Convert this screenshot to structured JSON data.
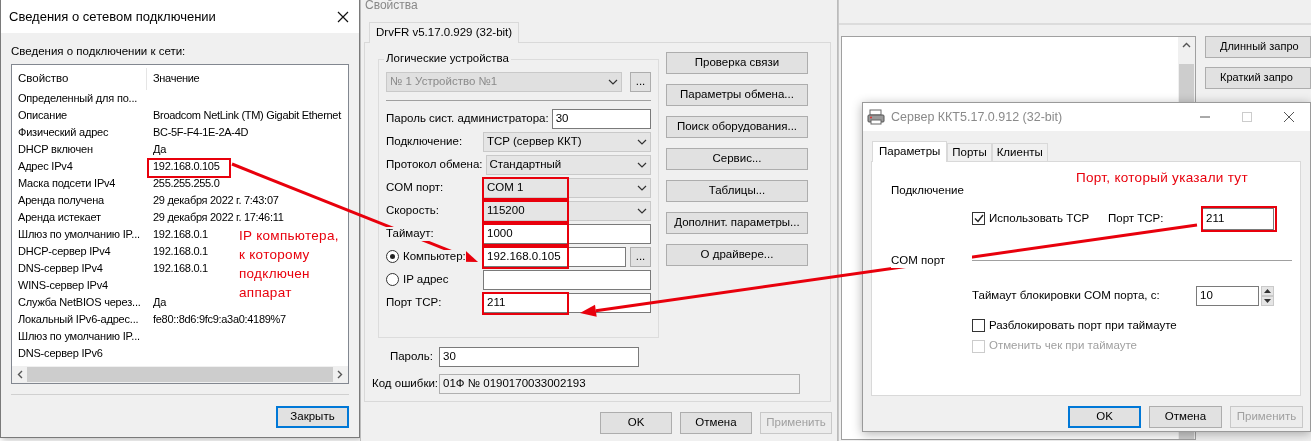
{
  "network_details_window": {
    "title": "Сведения о сетевом подключении",
    "caption": "Сведения о подключении к сети:",
    "columns": [
      "Свойство",
      "Значение"
    ],
    "rows": [
      {
        "property": "Определенный для по...",
        "highlighted": false
      },
      {
        "property": "Описание",
        "value": "Broadcom NetLink (TM) Gigabit Ethernet",
        "highlighted": false
      },
      {
        "property": "Физический адрес",
        "value": "BC-5F-F4-1E-2A-4D",
        "highlighted": false
      },
      {
        "property": "DHCP включен",
        "value": "Да",
        "highlighted": false
      },
      {
        "property": "Адрес IPv4",
        "value": "192.168.0.105",
        "highlighted": true
      },
      {
        "property": "Маска подсети IPv4",
        "value": "255.255.255.0",
        "highlighted": false
      },
      {
        "property": "Аренда получена",
        "value": "29 декабря 2022 г. 7:43:07",
        "highlighted": false
      },
      {
        "property": "Аренда истекает",
        "value": "29 декабря 2022 г. 17:46:11",
        "highlighted": false
      },
      {
        "property": "Шлюз по умолчанию IP...",
        "value": "192.168.0.1",
        "highlighted": false
      },
      {
        "property": "DHCP-сервер IPv4",
        "value": "192.168.0.1",
        "highlighted": false
      },
      {
        "property": "DNS-сервер IPv4",
        "value": "192.168.0.1",
        "highlighted": false
      },
      {
        "property": "WINS-сервер IPv4",
        "highlighted": false
      },
      {
        "property": "Служба NetBIOS через...",
        "value": "Да",
        "highlighted": false
      },
      {
        "property": "Локальный IPv6-адрес...",
        "value": "fe80::8d6:9fc9:a3a0:4189%7",
        "highlighted": false
      },
      {
        "property": "Шлюз по умолчанию IP...",
        "highlighted": false
      },
      {
        "property": "DNS-сервер IPv6",
        "highlighted": false
      }
    ],
    "buttons": [
      {
        "label": "Закрыть",
        "default": true,
        "disabled": false
      }
    ]
  },
  "properties_window": {
    "title": "Свойства",
    "tabs": [
      {
        "label": "DrvFR v5.17.0.929 (32-bit)",
        "selected": true
      }
    ],
    "group_label": "Логические устройства",
    "device": {
      "value": "№ 1 Устройство №1",
      "disabled": true,
      "browse_button": "..."
    },
    "fields": [
      {
        "kind": "input",
        "label": "Пароль сист. администратора:",
        "value": "30",
        "highlighted": false
      },
      {
        "kind": "select",
        "label": "Подключение:",
        "value": "TCP (сервер ККТ)",
        "highlighted": false
      },
      {
        "kind": "select",
        "label": "Протокол обмена:",
        "value": "Стандартный",
        "highlighted": false
      },
      {
        "kind": "select",
        "label": "COM порт:",
        "value": "COM 1",
        "highlighted": true
      },
      {
        "kind": "select",
        "label": "Скорость:",
        "value": "115200",
        "highlighted": true
      },
      {
        "kind": "input",
        "label": "Таймаут:",
        "value": "1000",
        "highlighted": true
      },
      {
        "kind": "radio",
        "label": "Компьютер:",
        "selected": true,
        "value": "192.168.0.105",
        "highlighted": true,
        "browse_button": "..."
      },
      {
        "kind": "radio",
        "label": "IP адрес",
        "selected": false,
        "highlighted": false
      },
      {
        "kind": "input",
        "label": "Порт TCP:",
        "value": "211",
        "highlighted": true
      }
    ],
    "side_buttons": [
      "Проверка связи",
      "Параметры обмена...",
      "Поиск оборудования...",
      "Сервис...",
      "Таблицы...",
      "Дополнит. параметры...",
      "О драйвере..."
    ],
    "password": {
      "label": "Пароль:",
      "value": "30"
    },
    "error_code": {
      "label": "Код ошибки:",
      "value": "01Ф № 0190170033002193"
    },
    "buttons": [
      {
        "label": "OK",
        "default": false,
        "disabled": false
      },
      {
        "label": "Отмена",
        "default": false,
        "disabled": false
      },
      {
        "label": "Применить",
        "default": false,
        "disabled": true
      }
    ]
  },
  "background_window": {
    "buttons": [
      "Длинный запро",
      "Краткий запро"
    ]
  },
  "server_window": {
    "title": "Сервер ККТ5.17.0.912 (32-bit)",
    "tabs": [
      {
        "label": "Параметры",
        "selected": true
      },
      {
        "label": "Порты",
        "selected": false
      },
      {
        "label": "Клиенты",
        "selected": false
      }
    ],
    "connection_section": "Подключение",
    "use_tcp": {
      "label": "Использовать TCP",
      "checked": true,
      "disabled": false
    },
    "tcp_port": {
      "label": "Порт TCP:",
      "value": "211",
      "highlighted": true
    },
    "com_section": "COM порт",
    "lock_timeout": {
      "label": "Таймаут блокировки COM порта, с:",
      "value": "10"
    },
    "options": [
      {
        "label": "Разблокировать порт при таймауте",
        "checked": false,
        "disabled": false
      },
      {
        "label": "Отменить чек при таймауте",
        "checked": false,
        "disabled": true
      }
    ],
    "buttons": [
      {
        "label": "OK",
        "default": true,
        "disabled": false
      },
      {
        "label": "Отмена",
        "default": false,
        "disabled": false
      },
      {
        "label": "Применить",
        "default": false,
        "disabled": true
      }
    ]
  },
  "annotations": [
    {
      "text": "IP компьютера, к которому подключен аппарат"
    },
    {
      "text": "Порт, который указали тут"
    }
  ]
}
